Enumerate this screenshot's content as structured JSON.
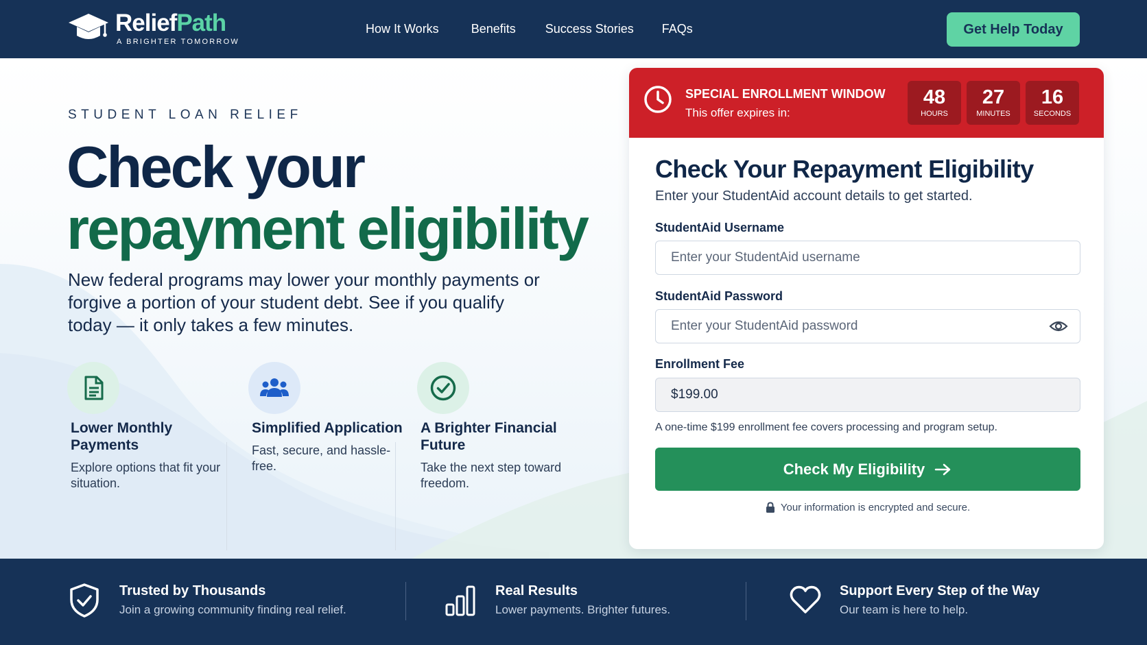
{
  "brand": {
    "name_part1": "Relief",
    "name_part2": "Path",
    "tagline": "A BRIGHTER TOMORROW"
  },
  "nav": {
    "links": [
      "How It Works",
      "Benefits",
      "Success Stories",
      "FAQs"
    ],
    "cta": "Get Help Today"
  },
  "hero": {
    "eyebrow": "STUDENT LOAN RELIEF",
    "headline_line1": "Check your",
    "headline_line2": "repayment eligibility",
    "subcopy": "New federal programs may lower your monthly payments or forgive a portion of your student debt. See if you qualify today — it only takes a few minutes.",
    "features": [
      {
        "icon": "document-icon",
        "title": "Lower Monthly Payments",
        "desc": "Explore options that fit your situation."
      },
      {
        "icon": "users-icon",
        "title": "Simplified Application",
        "desc": "Fast, secure, and hassle-free."
      },
      {
        "icon": "check-circle-icon",
        "title": "A Brighter Financial Future",
        "desc": "Take the next step toward freedom."
      }
    ]
  },
  "banner": {
    "title": "SPECIAL ENROLLMENT WINDOW",
    "subtitle": "This offer expires in:",
    "timers": [
      {
        "value": "48",
        "label": "HOURS"
      },
      {
        "value": "27",
        "label": "MINUTES"
      },
      {
        "value": "16",
        "label": "SECONDS"
      }
    ]
  },
  "form": {
    "title": "Check Your Repayment Eligibility",
    "subtitle": "Enter your StudentAid account details to get started.",
    "username_label": "StudentAid Username",
    "username_placeholder": "Enter your StudentAid username",
    "password_label": "StudentAid Password",
    "password_placeholder": "Enter your StudentAid password",
    "fee_label": "Enrollment Fee",
    "fee_value": "$199.00",
    "fee_note": "A one-time $199 enrollment fee covers processing and program setup.",
    "submit": "Check My Eligibility",
    "secure_note": "Your information is encrypted and secure."
  },
  "footer": {
    "items": [
      {
        "icon": "shield-check-icon",
        "title": "Trusted by Thousands",
        "desc": "Join a growing community finding real relief."
      },
      {
        "icon": "bar-chart-icon",
        "title": "Real Results",
        "desc": "Lower payments. Brighter futures."
      },
      {
        "icon": "heart-icon",
        "title": "Support Every Step of the Way",
        "desc": "Our team is here to help."
      }
    ]
  },
  "colors": {
    "navy": "#163257",
    "mint": "#5fd3a4",
    "headline_green": "#126a4a",
    "alert_red": "#cd2028",
    "button_green": "#24905a"
  }
}
